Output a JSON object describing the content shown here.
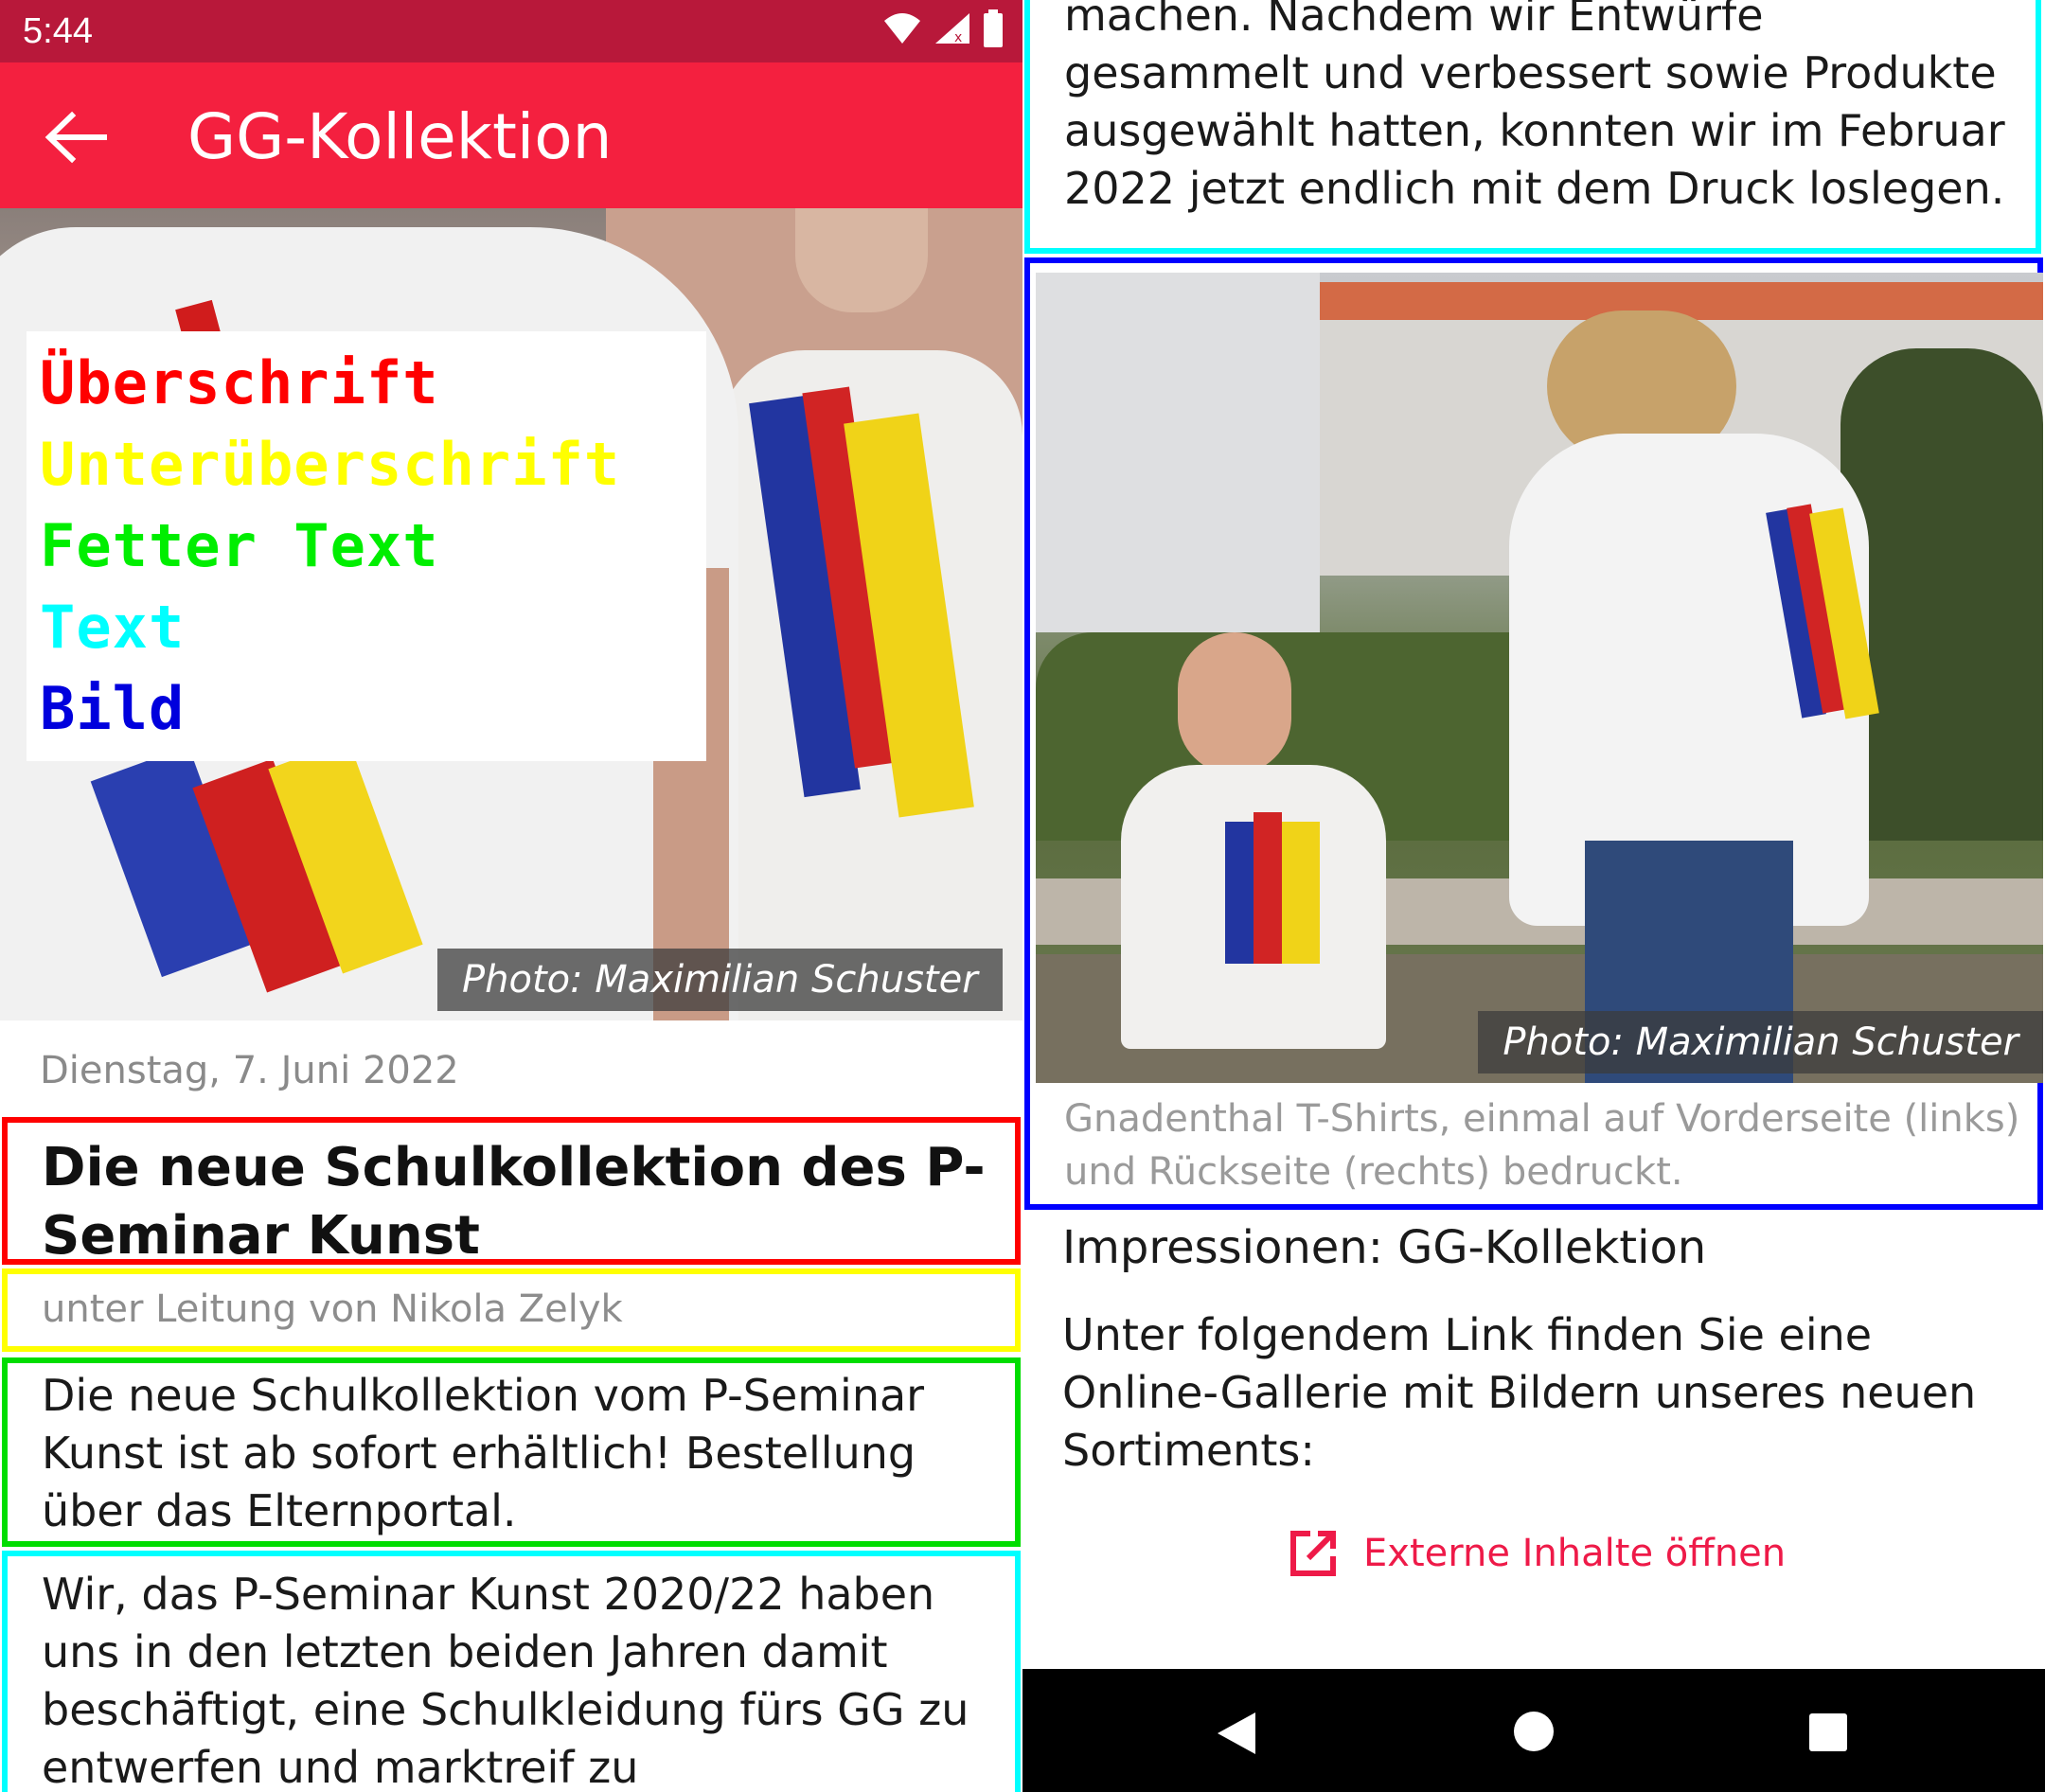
{
  "status_bar": {
    "time": "5:44"
  },
  "app_bar": {
    "title": "GG-Kollektion",
    "back_icon": "arrow-back-icon"
  },
  "hero": {
    "photo_credit": "Photo: Maximilian Schuster"
  },
  "legend": {
    "items": [
      {
        "label": "Überschrift",
        "color": "#ff0000"
      },
      {
        "label": "Unterüberschrift",
        "color": "#ffff00"
      },
      {
        "label": "Fetter Text",
        "color": "#00ee00"
      },
      {
        "label": "Text",
        "color": "#00ffff"
      },
      {
        "label": "Bild",
        "color": "#0000dd"
      }
    ]
  },
  "article": {
    "date": "Dienstag, 7. Juni 2022",
    "title": "Die neue Schulkollektion des P-Seminar Kunst",
    "subtitle": "unter Leitung von Nikola Zelyk",
    "bold_text": "Die neue Schulkollektion vom P-Seminar Kunst ist ab sofort erhältlich! Bestellung über das Elternportal.",
    "text_part1": "Wir, das P-Seminar Kunst 2020/22 haben uns in den letzten beiden Jahren damit beschäftigt, eine Schulkleidung fürs GG zu entwerfen und marktreif zu",
    "text_part2": "machen. Nachdem wir Entwürfe gesammelt und verbessert sowie Produkte ausgewählt hatten, konnten wir im Februar 2022 jetzt endlich mit dem Druck loslegen.",
    "image_credit": "Photo: Maximilian Schuster",
    "image_caption": "Gnadenthal T-Shirts, einmal auf Vorderseite (links) und Rückseite (rechts) bedruckt.",
    "section_title": "Impressionen: GG-Kollektion",
    "section_body": "Unter folgendem Link finden Sie eine Online-Gallerie mit Bildern unseres neuen Sortiments:",
    "external_link": "Externe Inhalte öffnen"
  },
  "colors": {
    "status_bar": "#b8183a",
    "app_bar": "#f4203f",
    "accent": "#ee1a48"
  }
}
